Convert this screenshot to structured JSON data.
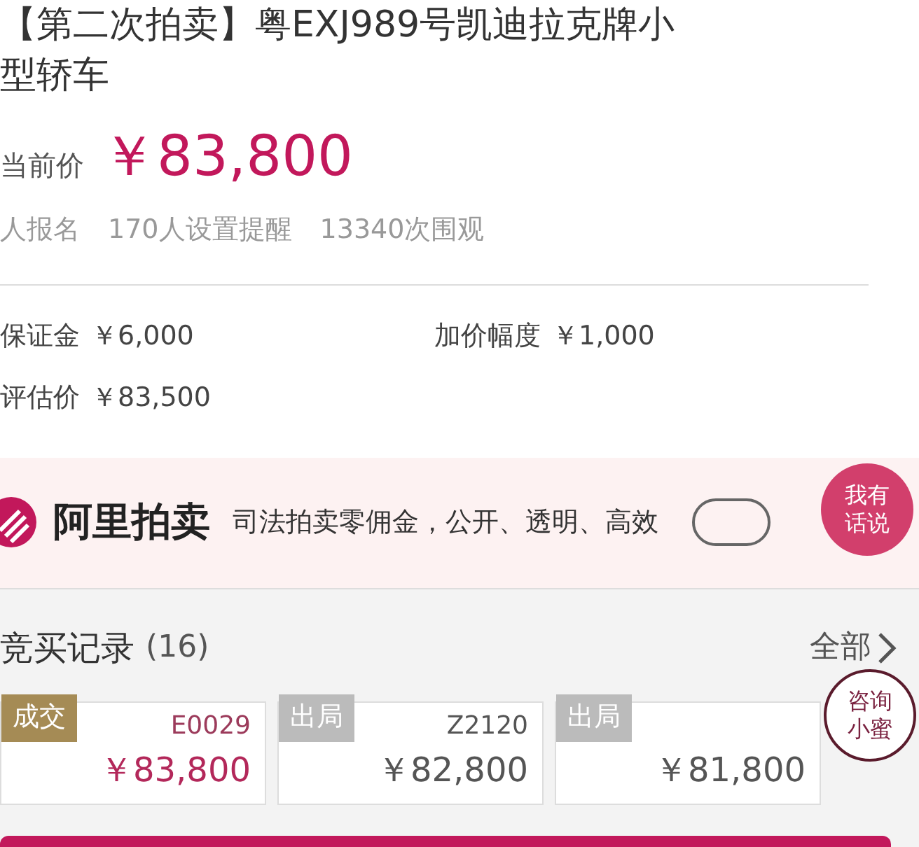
{
  "title": "【第二次拍卖】粤EXJ989号凯迪拉克牌小型轿车",
  "price": {
    "label": "当前价",
    "value": "￥83,800"
  },
  "stats": [
    "人报名",
    "170人设置提醒",
    "13340次围观"
  ],
  "terms": [
    {
      "label": "保证金",
      "value": "￥6,000"
    },
    {
      "label": "加价幅度",
      "value": "￥1,000"
    },
    {
      "label": "评估价",
      "value": "￥83,500"
    }
  ],
  "banner": {
    "brand": "阿里拍卖",
    "slogan": "司法拍卖零佣金，公开、透明、高效"
  },
  "records": {
    "title": "竞买记录",
    "count": "(16)",
    "link": "全部",
    "items": [
      {
        "status": "成交",
        "kind": "won",
        "id": "E0029",
        "price": "￥83,800"
      },
      {
        "status": "出局",
        "kind": "out",
        "id": "Z2120",
        "price": "￥82,800"
      },
      {
        "status": "出局",
        "kind": "out",
        "price": "￥81,800"
      }
    ]
  },
  "bubbles": [
    {
      "lines": [
        "我有",
        "话说"
      ],
      "kind": "filled"
    },
    {
      "lines": [
        "咨询",
        "小蜜"
      ],
      "kind": "outline"
    }
  ]
}
